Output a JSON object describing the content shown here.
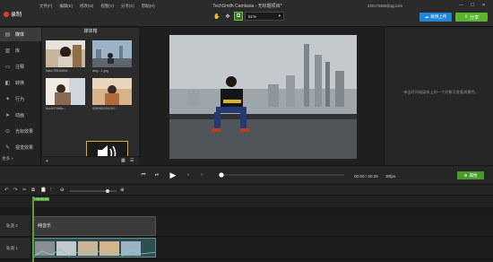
{
  "app": {
    "record_label": "录制",
    "title": "TechSmith Camtasia - 无标题项目*",
    "account": "240173456@qq.com",
    "menu": [
      "文件(F)",
      "编辑(E)",
      "修改(M)",
      "视图(V)",
      "分享(S)",
      "帮助(H)"
    ],
    "share_upload_label": "微博上传",
    "share_label": "分享",
    "zoom_value": "51%"
  },
  "sidebar": {
    "items": [
      {
        "label": "媒体",
        "icon": "film-icon"
      },
      {
        "label": "库",
        "icon": "library-icon"
      },
      {
        "label": "注释",
        "icon": "annotation-icon"
      },
      {
        "label": "转换",
        "icon": "transition-icon"
      },
      {
        "label": "行为",
        "icon": "behavior-icon"
      },
      {
        "label": "动画",
        "icon": "animation-icon"
      },
      {
        "label": "光标效果",
        "icon": "cursor-icon"
      },
      {
        "label": "视觉效果",
        "icon": "visual-effect-icon"
      }
    ],
    "more_label": "更多"
  },
  "bin": {
    "title": "媒体箱",
    "items": [
      {
        "label": "5abc7f50b5f4f..."
      },
      {
        "label": "dog...1.jpg"
      },
      {
        "label": "6cc6476f8b..."
      },
      {
        "label": "426652200252..."
      },
      {
        "label": "纯音乐.mp3"
      }
    ]
  },
  "properties": {
    "hint": "单击时间轴媒体上的一个对象可查看其属性。"
  },
  "playback": {
    "time": "00:00 / 00:25",
    "fps": "30fps",
    "properties_button": "属性",
    "progress": 0
  },
  "timeline": {
    "ticks": [
      "0:00:00;00",
      "0:00:10;00",
      "0:00:20;00",
      "0:00:30;00",
      "0:00:40;00",
      "0:00:50;00",
      "0:01:00;00",
      "0:01:10;00",
      "0:01:20;00",
      "0:01:30;00",
      "0:01:40;00"
    ],
    "playhead_time": "0:00:00;00",
    "tracks": [
      {
        "label": "轨道 2",
        "clip": "纯音乐"
      },
      {
        "label": "轨道 1",
        "clip": ""
      }
    ]
  },
  "colors": {
    "accent": "#5cb531",
    "record": "#e53935",
    "upload": "#1f88d8",
    "selection": "#e6a627"
  }
}
